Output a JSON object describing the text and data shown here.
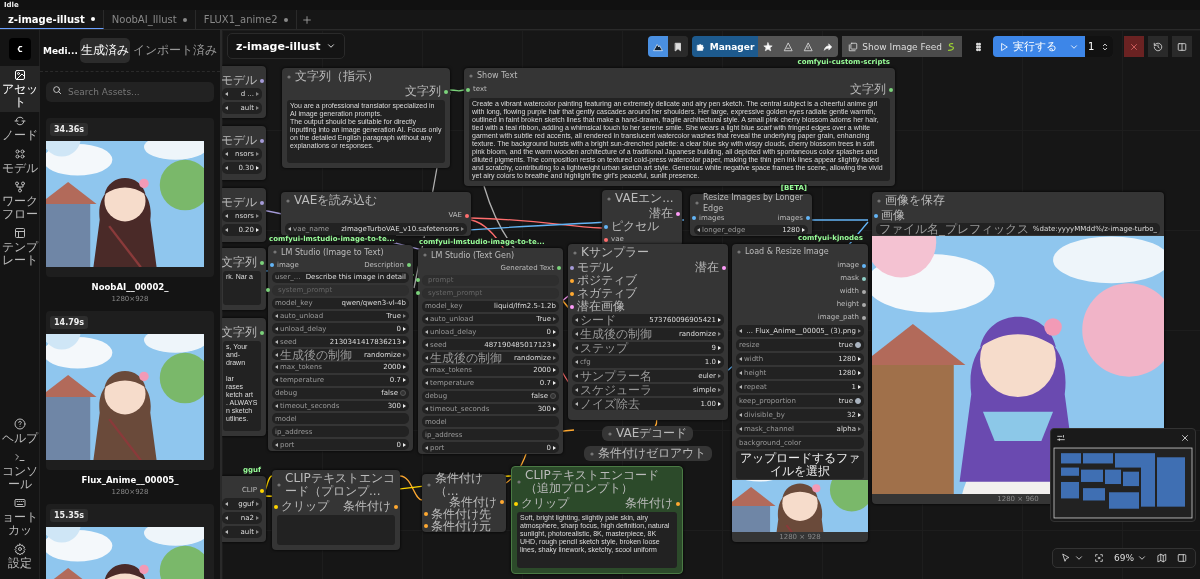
{
  "status": "Idle",
  "tabs": [
    {
      "label": "z-image-illust",
      "selected": true
    },
    {
      "label": "NoobAI_Illust",
      "selected": false
    },
    {
      "label": "FLUX1_anime2",
      "selected": false
    }
  ],
  "rail": {
    "top": [
      {
        "label": "アセット",
        "selected": true
      },
      {
        "label": "ノード",
        "selected": false
      },
      {
        "label": "モデル",
        "selected": false
      },
      {
        "label": "ワークフロー",
        "selected": false
      },
      {
        "label": "テンプレート",
        "selected": false
      }
    ],
    "bottom": [
      {
        "label": "ヘルプ"
      },
      {
        "label": "コンソール"
      },
      {
        "label": "ョートカッ"
      },
      {
        "label": "設定"
      }
    ]
  },
  "assets": {
    "title": "Medi...",
    "tabs": [
      {
        "label": "生成済み",
        "selected": true
      },
      {
        "label": "インポート済み",
        "selected": false
      }
    ],
    "search": {
      "placeholder": "Search Assets..."
    },
    "items": [
      {
        "duration": "34.36s",
        "name": "NoobAI__00002_",
        "size": "1280×928"
      },
      {
        "duration": "14.79s",
        "name": "Flux_Anime__00005_",
        "size": "1280×928"
      },
      {
        "duration": "15.35s"
      }
    ]
  },
  "workflow": {
    "name": "z-image-illust"
  },
  "toolbar": {
    "manager": "Manager",
    "feed": "Show Image Feed",
    "run": "実行する",
    "count": "1"
  },
  "nodes": [
    {
      "outputs": [
        {
          "label": "モデル",
          "color": "#a59bd8"
        }
      ],
      "widgets": [
        {
          "kind": "combo",
          "value": "d ..."
        },
        {
          "kind": "combo",
          "value": "ault"
        }
      ]
    },
    {
      "outputs": [
        {
          "label": "モデル",
          "color": "#a59bd8"
        }
      ],
      "widgets": [
        {
          "kind": "combo",
          "value": "nsors"
        },
        {
          "kind": "number",
          "value": "0.30"
        }
      ]
    },
    {
      "outputs": [
        {
          "label": "モデル",
          "color": "#a59bd8"
        }
      ],
      "widgets": [
        {
          "kind": "combo",
          "value": "nsors"
        },
        {
          "kind": "number",
          "value": "0.20"
        }
      ]
    },
    {
      "outputs": [
        {
          "label": "文字列",
          "color": "#7bd37b"
        }
      ],
      "text": "rk. Nar a"
    },
    {
      "outputs": [
        {
          "label": "文字列",
          "color": "#7bd37b"
        }
      ],
      "text": "s, Your\nand-drawn\n\nlar\nrases\nketch art\n. ALWAYS\nn sketch\nutlines."
    },
    {
      "badge": "gguf",
      "outputs": [
        {
          "label": "CLIP",
          "color": "#ffd500"
        }
      ],
      "widgets": [
        {
          "kind": "combo",
          "value": "gguf"
        },
        {
          "kind": "combo",
          "value": "na2"
        },
        {
          "kind": "combo",
          "value": "ault"
        }
      ]
    },
    {
      "title": "文字列（指示）",
      "outputs": [
        {
          "label": "文字列",
          "color": "#7bd37b"
        }
      ],
      "text": "You are a professional translator specialized in AI image generation prompts.\nThe output should be suitable for directly inputting into an image generation AI. Focus only on the detailed English paragraph without any explanations or responses."
    },
    {
      "title": "Show Text",
      "badge": "comfyui-custom-scripts",
      "inputs": [
        {
          "label": "text",
          "color": "#7bd37b"
        }
      ],
      "outputs": [
        {
          "label": "文字列",
          "color": "#7bd37b"
        }
      ],
      "text": "Create a vibrant watercolor painting featuring an extremely delicate and airy pen sketch. The central subject is a cheerful anime girl with long, flowing purple hair that gently cascades around her shoulders. Her large, expressive golden eyes radiate gentle warmth, outlined in faint broken sketch lines that make a hand-drawn, fragile architectural style. A small pink cherry blossom adorns her hair, tied with a teal ribbon, adding a whimsical touch to her serene smile. She wears a light blue scarf with fringed edges over a white garment with subtle red accents, all rendered in translucent watercolor washes that reveal the underlying paper grain, enhancing texture. The background bursts with a bright sun-drenched palette: a clear blue sky with wispy clouds, cherry blossom trees in soft pink bloom, and the warm wooden architecture of a traditional Japanese building, all depicted with spontaneous color splashes and diluted pigments. The composition rests on textured cold-press watercolor paper, making the thin pen ink lines appear slightly faded and scratchy, contributing to a lightweight urban sketch art style. Generous white negative space frames the scene, allowing the vivid yet airy colors to breathe and highlight the girl's peaceful, sunlit presence."
    },
    {
      "title": "VAEを読み込む",
      "outputs": [
        {
          "label": "VAE",
          "color": "#ff6e6e"
        }
      ],
      "widgets": [
        {
          "kind": "combo",
          "name": "vae_name",
          "value": "zImageTurboVAE_v10.safetensors"
        }
      ]
    },
    {
      "title": "VAEエン...",
      "inputs": [
        {
          "label": "ピクセル",
          "color": "#64b5f6"
        },
        {
          "label": "vae",
          "color": "#ff6e6e"
        }
      ],
      "outputs": [
        {
          "label": "潜在",
          "color": "#ff9cf9"
        }
      ]
    },
    {
      "title": "Resize Images by Longer Edge",
      "badge": "[BETA]",
      "inputs": [
        {
          "label": "images",
          "color": "#64b5f6"
        }
      ],
      "outputs": [
        {
          "label": "images",
          "color": "#64b5f6"
        }
      ],
      "widgets": [
        {
          "kind": "number",
          "name": "longer_edge",
          "value": "1280"
        }
      ]
    },
    {
      "title": "画像を保存",
      "inputs": [
        {
          "label": "画像",
          "color": "#64b5f6"
        }
      ],
      "widgets": [
        {
          "kind": "string",
          "name": "ファイル名_プレフィックス",
          "value": "%date:yyyyMMdd%/z-image-turbo_"
        }
      ],
      "preview": {
        "kind": "picture",
        "caption": "1280 × 960"
      }
    },
    {
      "title": "LM Studio (Image to Text)",
      "badge": "comfyui-lmstudio-image-to-te...",
      "inputs": [
        {
          "label": "image",
          "color": "#64b5f6"
        }
      ],
      "outputs": [
        {
          "label": "Description",
          "color": "#7bd37b"
        }
      ],
      "widgets": [
        {
          "kind": "string",
          "name": "user_...",
          "value": "Describe this image in detail"
        },
        {
          "kind": "socket",
          "name": "system_prompt",
          "color": "#7bd37b"
        },
        {
          "kind": "string",
          "name": "model_key",
          "value": "qwen/qwen3-vl-4b"
        },
        {
          "kind": "combo",
          "name": "auto_unload",
          "value": "True"
        },
        {
          "kind": "number",
          "name": "unload_delay",
          "value": "0"
        },
        {
          "kind": "number",
          "name": "seed",
          "value": "2130341417836213"
        },
        {
          "kind": "combo",
          "name": "生成後の制御",
          "value": "randomize"
        },
        {
          "kind": "number",
          "name": "max_tokens",
          "value": "2000"
        },
        {
          "kind": "number",
          "name": "temperature",
          "value": "0.7"
        },
        {
          "kind": "toggle",
          "name": "debug",
          "value": "false",
          "on": false
        },
        {
          "kind": "number",
          "name": "timeout_seconds",
          "value": "300"
        },
        {
          "kind": "string",
          "name": "model"
        },
        {
          "kind": "string",
          "name": "ip_address"
        },
        {
          "kind": "number",
          "name": "port",
          "value": "0"
        }
      ]
    },
    {
      "title": "LM Studio (Text Gen)",
      "badge": "comfyui-lmstudio-image-to-te...",
      "outputs": [
        {
          "label": "Generated Text",
          "color": "#7bd37b"
        }
      ],
      "widgets": [
        {
          "kind": "socket",
          "name": "prompt",
          "color": "#7bd37b"
        },
        {
          "kind": "socket",
          "name": "system_prompt",
          "color": "#7bd37b"
        },
        {
          "kind": "string",
          "name": "model_key",
          "value": "liquid/lfm2.5-1.2b"
        },
        {
          "kind": "combo",
          "name": "auto_unload",
          "value": "True"
        },
        {
          "kind": "number",
          "name": "unload_delay",
          "value": "0"
        },
        {
          "kind": "number",
          "name": "seed",
          "value": "487190485017123"
        },
        {
          "kind": "combo",
          "name": "生成後の制御",
          "value": "randomize"
        },
        {
          "kind": "number",
          "name": "max_tokens",
          "value": "2000"
        },
        {
          "kind": "number",
          "name": "temperature",
          "value": "0.7"
        },
        {
          "kind": "toggle",
          "name": "debug",
          "value": "false",
          "on": false
        },
        {
          "kind": "number",
          "name": "timeout_seconds",
          "value": "300"
        },
        {
          "kind": "string",
          "name": "model"
        },
        {
          "kind": "string",
          "name": "ip_address"
        },
        {
          "kind": "number",
          "name": "port",
          "value": "0"
        }
      ]
    },
    {
      "title": "Kサンプラー",
      "inputs": [
        {
          "label": "モデル",
          "color": "#a59bd8"
        },
        {
          "label": "ポジティブ",
          "color": "#ffa931"
        },
        {
          "label": "ネガティブ",
          "color": "#ffa931"
        },
        {
          "label": "潜在画像",
          "color": "#ff9cf9"
        }
      ],
      "outputs": [
        {
          "label": "潜在",
          "color": "#ff9cf9"
        }
      ],
      "widgets": [
        {
          "kind": "number",
          "name": "シード",
          "value": "573760096905421"
        },
        {
          "kind": "combo",
          "name": "生成後の制御",
          "value": "randomize"
        },
        {
          "kind": "number",
          "name": "ステップ",
          "value": "9"
        },
        {
          "kind": "number",
          "name": "cfg",
          "value": "1.0"
        },
        {
          "kind": "combo",
          "name": "サンプラー名",
          "value": "euler"
        },
        {
          "kind": "combo",
          "name": "スケジューラ",
          "value": "simple"
        },
        {
          "kind": "number",
          "name": "ノイズ除去",
          "value": "1.00"
        }
      ]
    },
    {
      "title": "Load & Resize Image",
      "badge": "comfyui-kjnodes",
      "outputs": [
        {
          "label": "image",
          "color": "#64b5f6"
        },
        {
          "label": "mask",
          "color": "#8fd0c8"
        },
        {
          "label": "width",
          "color": "#aaaaaa"
        },
        {
          "label": "height",
          "color": "#aaaaaa"
        },
        {
          "label": "image_path",
          "color": "#aaaaaa"
        }
      ],
      "widgets": [
        {
          "kind": "combo",
          "value": "... Flux_Anime__00005_ (3).png"
        },
        {
          "kind": "toggle",
          "name": "resize",
          "value": "true",
          "on": true
        },
        {
          "kind": "number",
          "name": "width",
          "value": "1280"
        },
        {
          "kind": "number",
          "name": "height",
          "value": "1280"
        },
        {
          "kind": "number",
          "name": "repeat",
          "value": "1"
        },
        {
          "kind": "toggle",
          "name": "keep_proportion",
          "value": "true",
          "on": true
        },
        {
          "kind": "number",
          "name": "divisible_by",
          "value": "32"
        },
        {
          "kind": "combo",
          "name": "mask_channel",
          "value": "alpha"
        },
        {
          "kind": "string",
          "name": "background_color"
        },
        {
          "kind": "button",
          "label": "アップロードするファイルを選択"
        }
      ],
      "preview": {
        "kind": "picture",
        "caption": "1280 × 928"
      }
    },
    {
      "title": "CLIPテキストエンコード（プロンプ...",
      "inputs": [
        {
          "label": "クリップ",
          "color": "#ffd500"
        }
      ],
      "outputs": [
        {
          "label": "条件付け",
          "color": "#ffa931"
        }
      ],
      "text_area": true
    },
    {
      "title": "条件付け（...",
      "inputs": [
        {
          "label": "条件付け先",
          "color": "#ffa931"
        },
        {
          "label": "条件付け元",
          "color": "#ffa931"
        }
      ],
      "outputs": [
        {
          "label": "条件付け",
          "color": "#ffa931"
        }
      ]
    },
    {
      "title": "CLIPテキストエンコード（追加プロンプト）",
      "color": "#2c4a2a",
      "inputs": [
        {
          "label": "クリップ",
          "color": "#ffd500"
        }
      ],
      "outputs": [
        {
          "label": "条件付け",
          "color": "#ffa931"
        }
      ],
      "text": "Soft, bright lighting, slightly pale skin, airy atmosphere, sharp focus, high definition, natural sunlight, photorealistic, 8K, masterpiece, 8K UHD, rough pencil sketch style, broken loose lines, shaky linework, sketchy, scool uniform"
    }
  ],
  "collapsed_nodes": [
    {
      "title": "VAEデコード"
    },
    {
      "title": "条件付けゼロアウト"
    }
  ],
  "zoom": "69%"
}
